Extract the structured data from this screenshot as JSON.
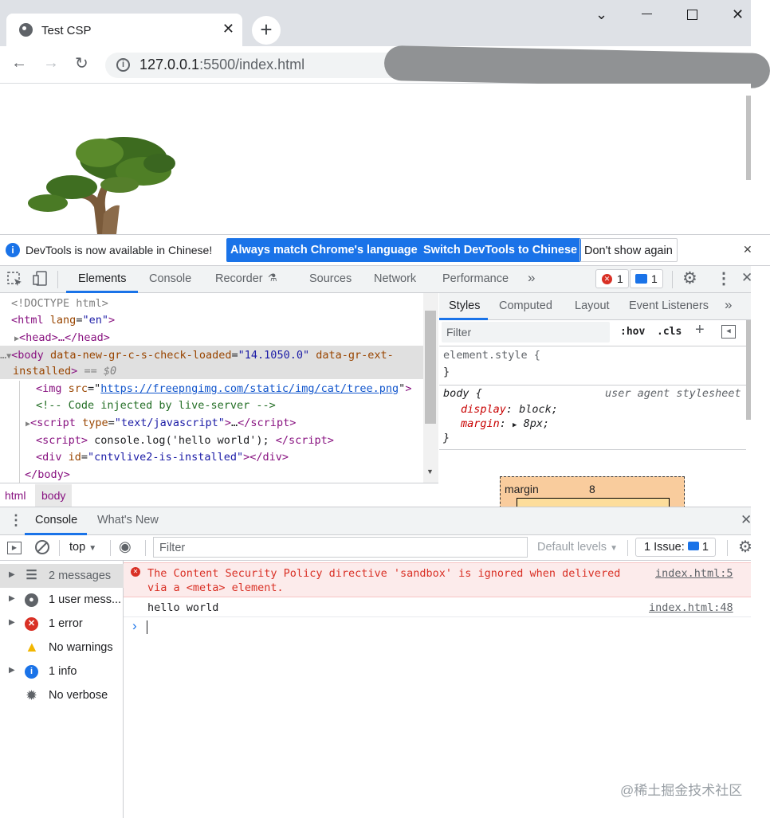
{
  "browser": {
    "tab_title": "Test CSP",
    "new_tab": "+",
    "url_host": "127.0.0.1",
    "url_rest": ":5500/index.html"
  },
  "infobar": {
    "message": "DevTools is now available in Chinese!",
    "btn_match": "Always match Chrome's language",
    "btn_switch": "Switch DevTools to Chinese",
    "btn_dismiss": "Don't show again"
  },
  "devtools": {
    "tabs": [
      "Elements",
      "Console",
      "Recorder",
      "Sources",
      "Network",
      "Performance"
    ],
    "more": "»",
    "errors_count": "1",
    "issues_count": "1"
  },
  "dom": {
    "doctype": "<!DOCTYPE html>",
    "html_tag": "html",
    "lang_attr": "lang",
    "lang_val": "\"en\"",
    "head": "head",
    "head_ellipsis": "…</head>",
    "body_attr1": "data-new-gr-c-s-check-loaded",
    "body_val1": "\"14.1050.0\"",
    "body_attr2": "data-gr-ext-",
    "body_attr2b": "installed",
    "dollar0": "== $0",
    "img_attr": "src",
    "img_src": "https://freepngimg.com/static/img/cat/tree.png",
    "comment": "<!-- Code injected by live-server -->",
    "script1_attr": "type",
    "script1_val": "\"text/javascript\"",
    "script2_text": " console.log('hello world'); ",
    "div_attr": "id",
    "div_val": "\"cntvlive2-is-installed\"",
    "body_close": "</body>"
  },
  "breadcrumbs": [
    "html",
    "body"
  ],
  "styles": {
    "tabs": [
      "Styles",
      "Computed",
      "Layout",
      "Event Listeners"
    ],
    "filter_placeholder": "Filter",
    "hov": ":hov",
    "cls": ".cls",
    "element_style": "element.style {",
    "close_brace": "}",
    "body_selector": "body {",
    "ua_label": "user agent stylesheet",
    "prop1": "display",
    "val1": "block;",
    "prop2": "margin",
    "val2": "8px;",
    "box_label": "margin",
    "box_value": "8"
  },
  "console": {
    "drawer_tabs": [
      "Console",
      "What's New"
    ],
    "context": "top",
    "filter_placeholder": "Filter",
    "levels": "Default levels",
    "issues_label": "1 Issue:",
    "issues_count": "1",
    "sidebar": [
      {
        "label": "2 messages",
        "icon": "list-icon"
      },
      {
        "label": "1 user mess...",
        "icon": "user-icon"
      },
      {
        "label": "1 error",
        "icon": "error-icon"
      },
      {
        "label": "No warnings",
        "icon": "warning-icon"
      },
      {
        "label": "1 info",
        "icon": "info-icon"
      },
      {
        "label": "No verbose",
        "icon": "bug-icon"
      }
    ],
    "error_line1": "The Content Security Policy directive 'sandbox' is ignored when delivered",
    "error_line2": "via a <meta> element.",
    "error_source": "index.html:5",
    "log_text": "hello world",
    "log_source": "index.html:48",
    "prompt": "›"
  },
  "watermark": "@稀土掘金技术社区",
  "colors": {
    "accent": "#1a73e8",
    "error": "#d93025",
    "error_bg": "#fcebeb"
  }
}
